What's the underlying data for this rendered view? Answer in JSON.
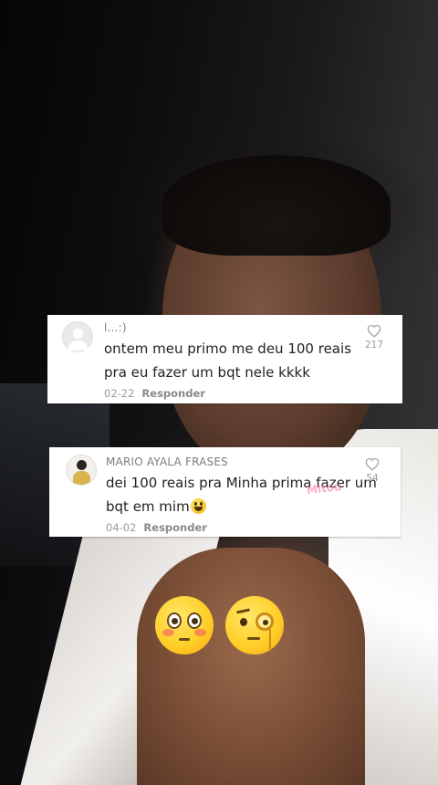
{
  "comments": [
    {
      "username": "l...:)",
      "text": "ontem meu primo me deu 100 reais pra eu fazer um bqt nele kkkk",
      "date": "02-22",
      "reply_label": "Responder",
      "likes": "217"
    },
    {
      "username": "MARIO AYALA FRASES",
      "text": "dei 100 reais pra Minha prima fazer um bqt em mim",
      "date": "04-02",
      "reply_label": "Responder",
      "likes": "54"
    }
  ],
  "watermark": "Mitou",
  "icons": {
    "like": "heart-outline-icon",
    "inline_emoji": "grinning-face-icon",
    "reactions": [
      "flushed-face-icon",
      "face-with-monocle-icon"
    ]
  },
  "colors": {
    "card_bg": "#ffffff",
    "text": "#222222",
    "muted": "#9a9a9a",
    "emoji_yellow": "#ffd02a"
  }
}
